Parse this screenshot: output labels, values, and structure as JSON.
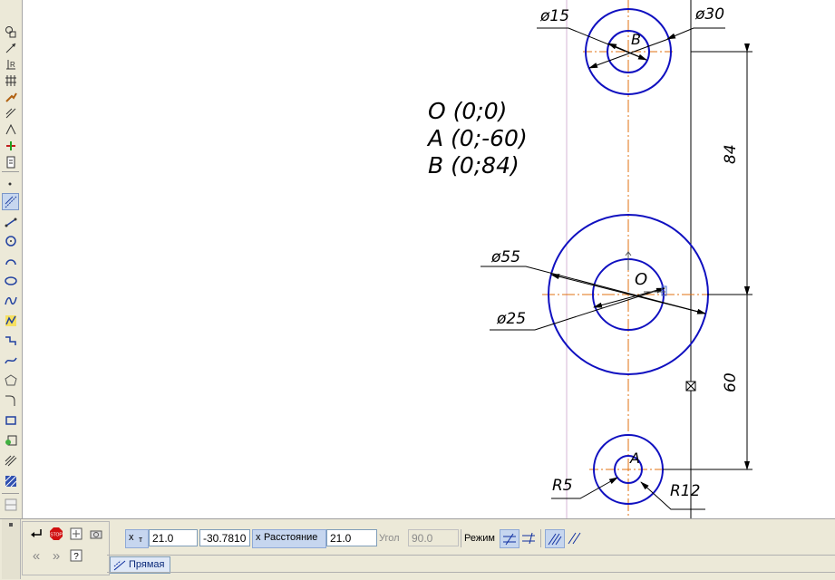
{
  "app": {
    "window": "KOMPAS-3D drawing canvas"
  },
  "left_toolbar": {
    "upper_tools": [
      "geometry-icon",
      "dimensions-icon",
      "designations-icon",
      "editing-icon",
      "parametrization-icon",
      "measure-icon",
      "select-icon",
      "spec-icon",
      "report-icon"
    ],
    "lower_tools": [
      "point-icon",
      "auxiliary-line-icon",
      "segment-icon",
      "circle-icon",
      "arc-icon",
      "ellipse-icon",
      "continuous-input-icon",
      "polyline-icon",
      "nurbs-icon",
      "bezier-icon",
      "polygon-icon",
      "fillet-icon",
      "rectangle-icon",
      "contour-icon",
      "equidistant-icon",
      "hatch-icon",
      "grid-icon"
    ]
  },
  "drawing": {
    "note_lines": [
      "O (0;0)",
      "A (0;-60)",
      "B (0;84)"
    ],
    "point_labels": {
      "O": "O",
      "A": "A",
      "B": "B"
    },
    "dimensions": {
      "d15": "ø15",
      "d30": "ø30",
      "d55": "ø55",
      "d25": "ø25",
      "r5": "R5",
      "r12": "R12",
      "v84": "84",
      "v60": "60"
    },
    "colors": {
      "contour": "#1010c0",
      "axis": "#e07010",
      "dim": "#000000",
      "aux": "#c8a0c8",
      "lock": "#4a6fd0"
    }
  },
  "properties": {
    "x_value": "21.0",
    "y_value": "-30.7810",
    "distance_label": "Расстояние",
    "distance_value": "21.0",
    "angle_label": "Угол",
    "angle_value": "90.0",
    "mode_label": "Режим",
    "tab_label": "Прямая",
    "x_lock_label": "x",
    "t_label": "т",
    "dist_lock_label": "x"
  }
}
